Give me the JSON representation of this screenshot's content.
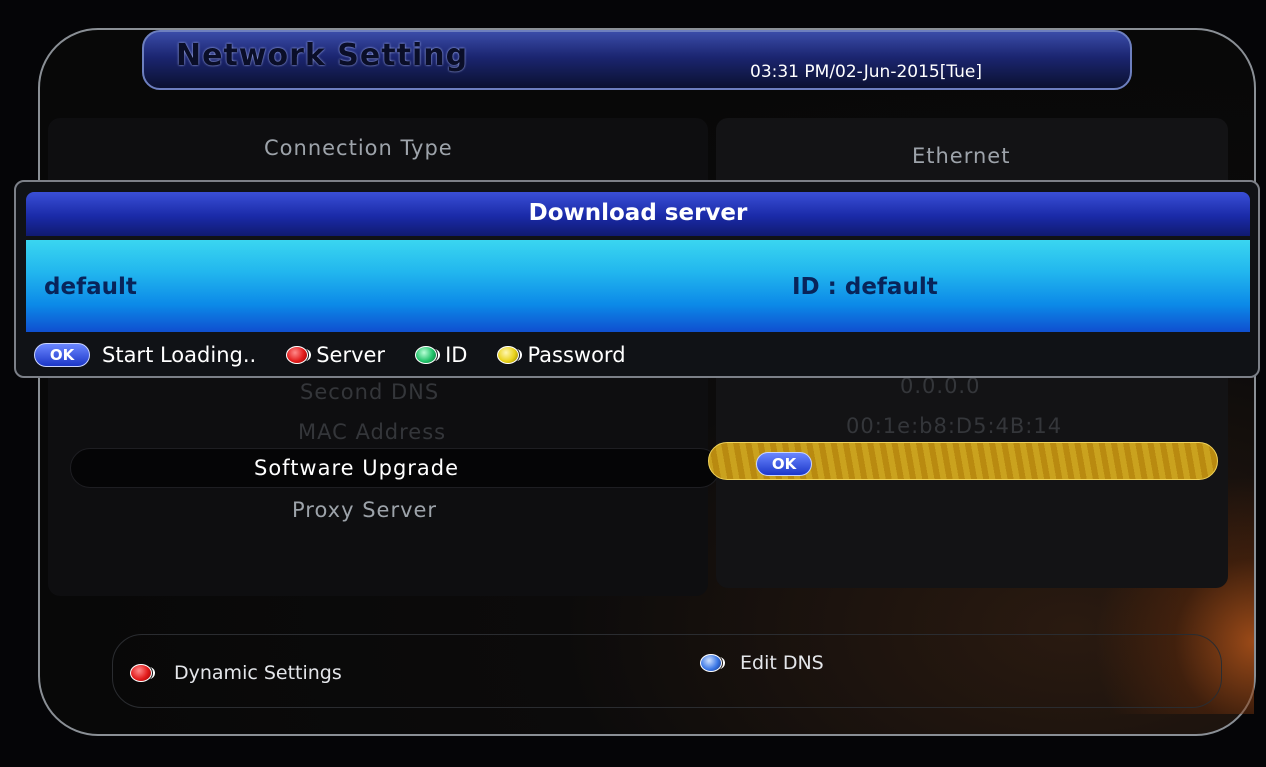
{
  "header": {
    "title": "Network Setting",
    "datetime": "03:31 PM/02-Jun-2015[Tue]"
  },
  "settings": {
    "rows": [
      {
        "label": "Connection Type",
        "value": "Ethernet"
      },
      {
        "label": "Second DNS",
        "value": "0.0.0.0"
      },
      {
        "label": "MAC Address",
        "value": "00:1e:b8:D5:4B:14"
      }
    ],
    "software_upgrade": {
      "label": "Software Upgrade",
      "button": "OK"
    },
    "proxy_server": {
      "label": "Proxy Server"
    }
  },
  "dialog": {
    "title": "Download server",
    "selected_row": {
      "server": "default",
      "id": "ID : default"
    },
    "hints": {
      "ok": "OK",
      "start": "Start Loading..",
      "server": "Server",
      "id": "ID",
      "password": "Password"
    }
  },
  "footer": {
    "dynamic_settings": "Dynamic Settings",
    "edit_dns": "Edit DNS"
  },
  "colors": {
    "header_blue": "#1b2570",
    "selection_cyan": "#22b6ee",
    "upgrade_gold": "#caa21e",
    "red_key": "#e31c1c",
    "green_key": "#23c36b",
    "yellow_key": "#e9d21a"
  }
}
